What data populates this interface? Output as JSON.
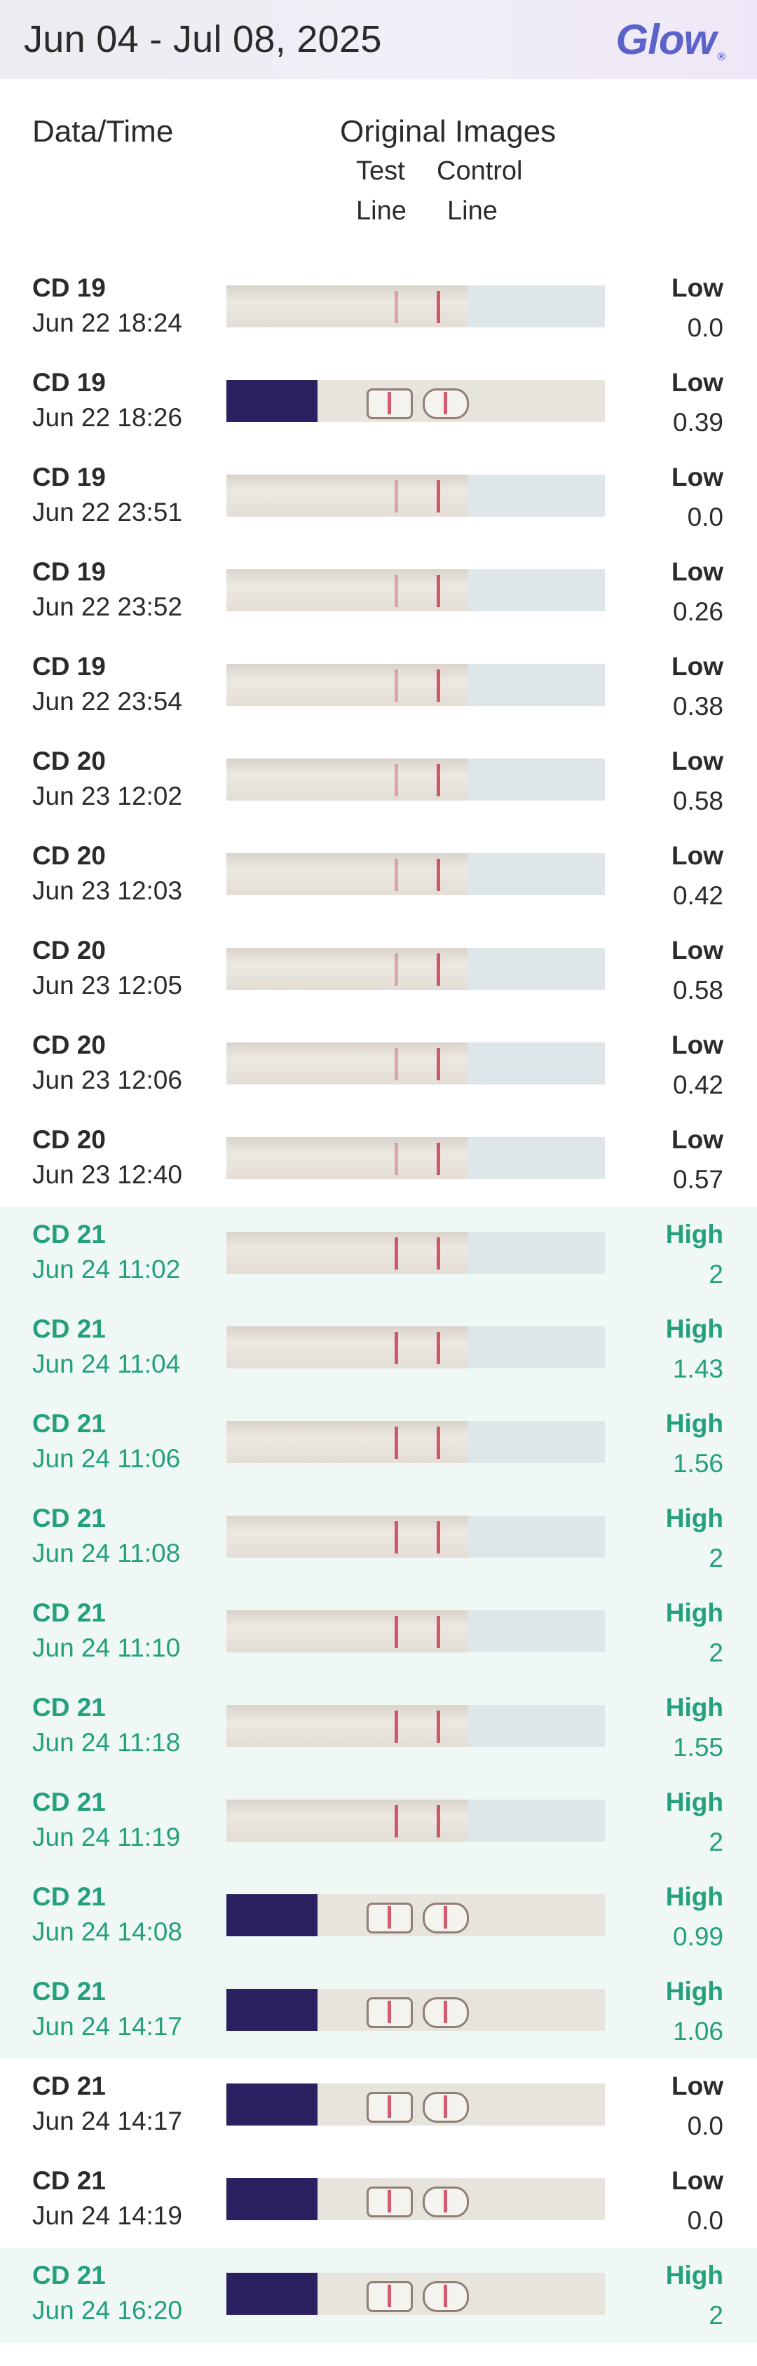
{
  "header": {
    "date_range": "Jun 04 - Jul 08, 2025",
    "logo": "Glow",
    "logo_mark": "®"
  },
  "columns": {
    "date_time": "Data/Time",
    "original_images": "Original Images",
    "test": "Test",
    "control": "Control",
    "line_test": "Line",
    "line_control": "Line"
  },
  "colors": {
    "high": "#25a07c",
    "high_bg": "#eff8f5",
    "text": "#2b2b2b",
    "logo": "#5b63c9"
  },
  "rows": [
    {
      "cd": "CD 19",
      "time": "Jun 22 18:24",
      "level": "Low",
      "value": "0.0",
      "high": false,
      "image": "strip-lh"
    },
    {
      "cd": "CD 19",
      "time": "Jun 22 18:26",
      "level": "Low",
      "value": "0.39",
      "high": false,
      "image": "cassette"
    },
    {
      "cd": "CD 19",
      "time": "Jun 22 23:51",
      "level": "Low",
      "value": "0.0",
      "high": false,
      "image": "strip-lh"
    },
    {
      "cd": "CD 19",
      "time": "Jun 22 23:52",
      "level": "Low",
      "value": "0.26",
      "high": false,
      "image": "strip-lh"
    },
    {
      "cd": "CD 19",
      "time": "Jun 22 23:54",
      "level": "Low",
      "value": "0.38",
      "high": false,
      "image": "strip-lh"
    },
    {
      "cd": "CD 20",
      "time": "Jun 23 12:02",
      "level": "Low",
      "value": "0.58",
      "high": false,
      "image": "strip-lh"
    },
    {
      "cd": "CD 20",
      "time": "Jun 23 12:03",
      "level": "Low",
      "value": "0.42",
      "high": false,
      "image": "strip-lh"
    },
    {
      "cd": "CD 20",
      "time": "Jun 23 12:05",
      "level": "Low",
      "value": "0.58",
      "high": false,
      "image": "strip-lh"
    },
    {
      "cd": "CD 20",
      "time": "Jun 23 12:06",
      "level": "Low",
      "value": "0.42",
      "high": false,
      "image": "strip-lh"
    },
    {
      "cd": "CD 20",
      "time": "Jun 23 12:40",
      "level": "Low",
      "value": "0.57",
      "high": false,
      "image": "strip-lh"
    },
    {
      "cd": "CD 21",
      "time": "Jun 24 11:02",
      "level": "High",
      "value": "2",
      "high": true,
      "image": "strip-lh"
    },
    {
      "cd": "CD 21",
      "time": "Jun 24 11:04",
      "level": "High",
      "value": "1.43",
      "high": true,
      "image": "strip-lh"
    },
    {
      "cd": "CD 21",
      "time": "Jun 24 11:06",
      "level": "High",
      "value": "1.56",
      "high": true,
      "image": "strip-lh"
    },
    {
      "cd": "CD 21",
      "time": "Jun 24 11:08",
      "level": "High",
      "value": "2",
      "high": true,
      "image": "strip-lh"
    },
    {
      "cd": "CD 21",
      "time": "Jun 24 11:10",
      "level": "High",
      "value": "2",
      "high": true,
      "image": "strip-lh"
    },
    {
      "cd": "CD 21",
      "time": "Jun 24 11:18",
      "level": "High",
      "value": "1.55",
      "high": true,
      "image": "strip-lh"
    },
    {
      "cd": "CD 21",
      "time": "Jun 24 11:19",
      "level": "High",
      "value": "2",
      "high": true,
      "image": "strip-lh"
    },
    {
      "cd": "CD 21",
      "time": "Jun 24 14:08",
      "level": "High",
      "value": "0.99",
      "high": true,
      "image": "cassette"
    },
    {
      "cd": "CD 21",
      "time": "Jun 24 14:17",
      "level": "High",
      "value": "1.06",
      "high": true,
      "image": "cassette"
    },
    {
      "cd": "CD 21",
      "time": "Jun 24 14:17",
      "level": "Low",
      "value": "0.0",
      "high": false,
      "image": "cassette"
    },
    {
      "cd": "CD 21",
      "time": "Jun 24 14:19",
      "level": "Low",
      "value": "0.0",
      "high": false,
      "image": "cassette"
    },
    {
      "cd": "CD 21",
      "time": "Jun 24 16:20",
      "level": "High",
      "value": "2",
      "high": true,
      "image": "cassette"
    }
  ]
}
